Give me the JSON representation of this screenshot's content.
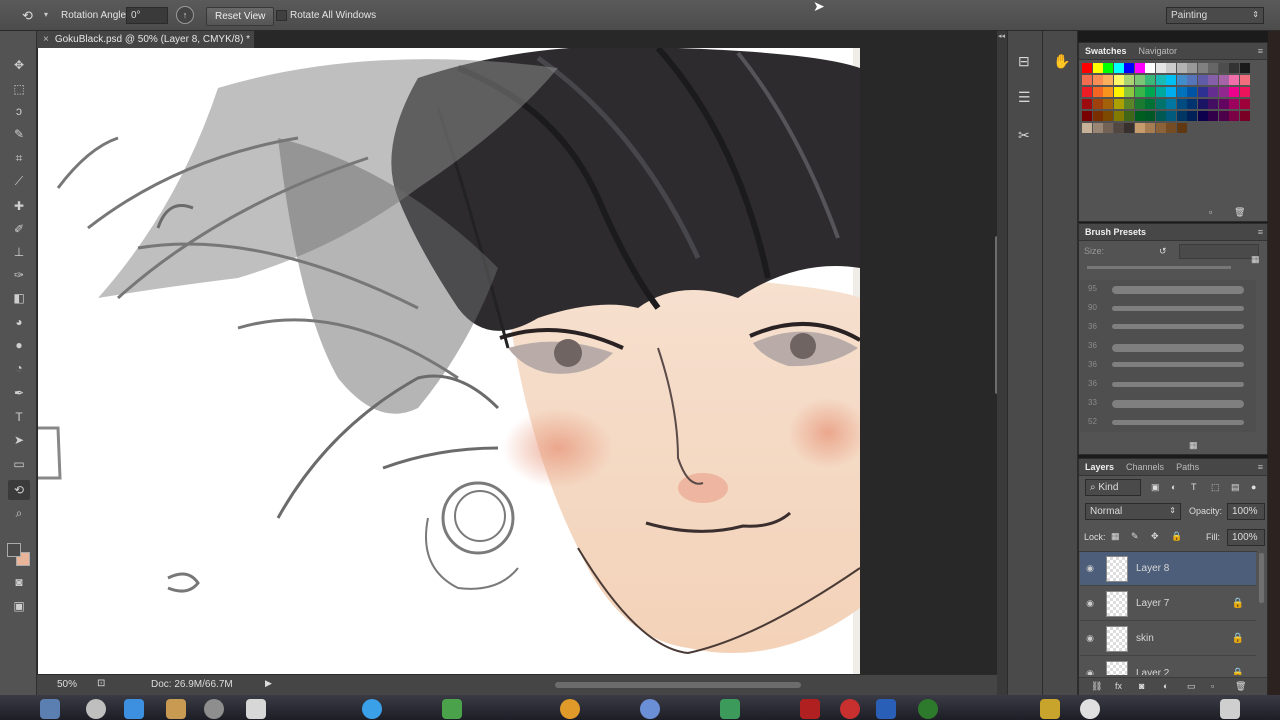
{
  "options_bar": {
    "rotation_label": "Rotation Angle:",
    "rotation_value": "0°",
    "reset_view": "Reset View",
    "rotate_all": "Rotate All Windows",
    "workspace": "Painting"
  },
  "document": {
    "tab_title": "GokuBlack.psd @ 50% (Layer 8, CMYK/8) *",
    "zoom": "50%",
    "doc_size": "Doc: 26.9M/66.7M"
  },
  "swatches_panel": {
    "tabs": [
      "Swatches",
      "Navigator"
    ]
  },
  "brush_panel": {
    "title": "Brush Presets",
    "size_label": "Size:",
    "brush_sizes": [
      "95",
      "90",
      "36",
      "36",
      "36",
      "36",
      "33",
      "52"
    ]
  },
  "layers_panel": {
    "tabs": [
      "Layers",
      "Channels",
      "Paths"
    ],
    "kind": "Kind",
    "blend_mode": "Normal",
    "opacity_label": "Opacity:",
    "opacity": "100%",
    "lock_label": "Lock:",
    "fill_label": "Fill:",
    "fill": "100%",
    "layers": [
      {
        "name": "Layer 8",
        "selected": true,
        "locked": false
      },
      {
        "name": "Layer 7",
        "selected": false,
        "locked": true
      },
      {
        "name": "skin",
        "selected": false,
        "locked": true
      },
      {
        "name": "Layer 2",
        "selected": false,
        "locked": true
      }
    ]
  },
  "colors": {
    "foreground": "#4a4a4a",
    "background": "#e8b49a",
    "selected_layer": "#4d5e7a"
  }
}
